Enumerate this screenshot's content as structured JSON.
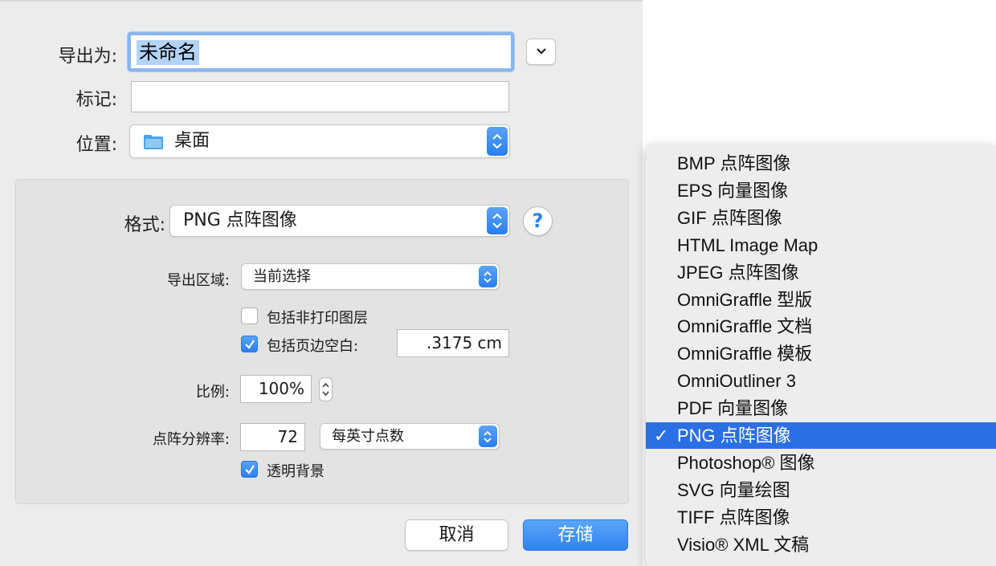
{
  "dialog": {
    "export_as_label": "导出为:",
    "export_as_value": "未命名",
    "tags_label": "标记:",
    "tags_value": "",
    "location_label": "位置:",
    "location_value": "桌面",
    "format_label": "格式:",
    "format_value": "PNG 点阵图像",
    "help_label": "?",
    "export_area_label": "导出区域:",
    "export_area_value": "当前选择",
    "include_nonprint_label": "包括非打印图层",
    "include_nonprint_checked": false,
    "include_margin_label": "包括页边空白:",
    "include_margin_checked": true,
    "margin_value": ".3175 cm",
    "scale_label": "比例:",
    "scale_value": "100%",
    "resolution_label": "点阵分辨率:",
    "resolution_value": "72",
    "resolution_unit": "每英寸点数",
    "transparent_bg_label": "透明背景",
    "transparent_bg_checked": true,
    "cancel_label": "取消",
    "save_label": "存储"
  },
  "format_menu": {
    "items": [
      {
        "label": "BMP 点阵图像",
        "selected": false
      },
      {
        "label": "EPS 向量图像",
        "selected": false
      },
      {
        "label": "GIF 点阵图像",
        "selected": false
      },
      {
        "label": "HTML Image Map",
        "selected": false
      },
      {
        "label": "JPEG 点阵图像",
        "selected": false
      },
      {
        "label": "OmniGraffle 型版",
        "selected": false
      },
      {
        "label": "OmniGraffle 文档",
        "selected": false
      },
      {
        "label": "OmniGraffle 模板",
        "selected": false
      },
      {
        "label": "OmniOutliner 3",
        "selected": false
      },
      {
        "label": "PDF 向量图像",
        "selected": false
      },
      {
        "label": "PNG 点阵图像",
        "selected": true
      },
      {
        "label": "Photoshop® 图像",
        "selected": false
      },
      {
        "label": "SVG 向量绘图",
        "selected": false
      },
      {
        "label": "TIFF 点阵图像",
        "selected": false
      },
      {
        "label": "Visio® XML 文稿",
        "selected": false
      }
    ],
    "check_mark": "✓"
  },
  "colors": {
    "accent": "#2b6fe5",
    "dialog_bg": "#ececec",
    "panel_bg": "#e3e3e3"
  }
}
